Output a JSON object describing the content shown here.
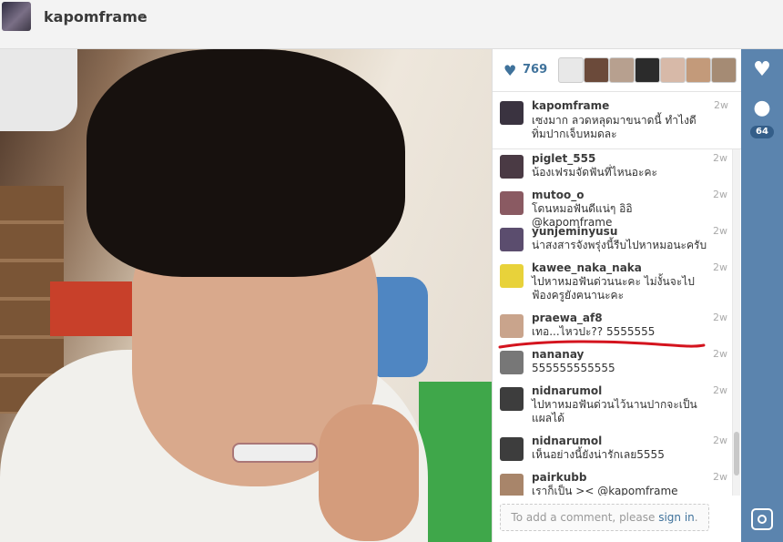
{
  "header": {
    "username": "kapomframe",
    "caret": "▾"
  },
  "likes": {
    "count": "769",
    "heart_icon": "heart-icon",
    "avatars": [
      "#e8e8e8",
      "#6b4a3a",
      "#b7a08f",
      "#2b2b2b",
      "#d7b9a8",
      "#c39a7a",
      "#a58b74"
    ]
  },
  "caption": {
    "user": "kapomframe",
    "time": "2w",
    "text": "เซงมาก ลวดหลุดมาขนาดนี้ ทำไงดี ทิ่มปากเจ็บหมดละ"
  },
  "comments": [
    {
      "user": "piglet_555",
      "time": "2w",
      "text": "น้องเฟรมจัดฟันที่ไหนอะคะ",
      "color": "#4a3a44"
    },
    {
      "user": "mutoo_o",
      "time": "2w",
      "text": "โดนหมอฟันดีแน่ๆ อิอิ @kapomframe",
      "color": "#8a5a62"
    },
    {
      "user": "yunjeminyusu",
      "time": "2w",
      "text": "น่าสงสารจังพรุ่งนี้รีบไปหาหมอนะครับ",
      "color": "#5b4d6e"
    },
    {
      "user": "kawee_naka_naka",
      "time": "2w",
      "text": "ไปหาหมอฟันด่วนนะคะ ไม่งั้นจะไปฟ้องครูยังฅนานะคะ",
      "color": "#e8d23a"
    },
    {
      "user": "praewa_af8",
      "time": "2w",
      "text": "เทอ...ไหวปะ?? 5555555",
      "color": "#c9a48c"
    },
    {
      "user": "nananay",
      "time": "2w",
      "text": "555555555555",
      "color": "#777777"
    },
    {
      "user": "nidnarumol",
      "time": "2w",
      "text": "ไปหาหมอฟันด่วนไว้นานปากจะเป็นแผลได้",
      "color": "#3d3d3d"
    },
    {
      "user": "nidnarumol",
      "time": "2w",
      "text": "เห็นอย่างนี้ยังน่ารักเลย5555",
      "color": "#3d3d3d"
    },
    {
      "user": "pairkubb",
      "time": "2w",
      "text": "เราก็เป็น >< @kapomframe",
      "color": "#a8856a"
    }
  ],
  "add_comment": {
    "prefix": "To add a comment, please ",
    "link": "sign in",
    "suffix": "."
  },
  "rail": {
    "comment_count": "64"
  }
}
